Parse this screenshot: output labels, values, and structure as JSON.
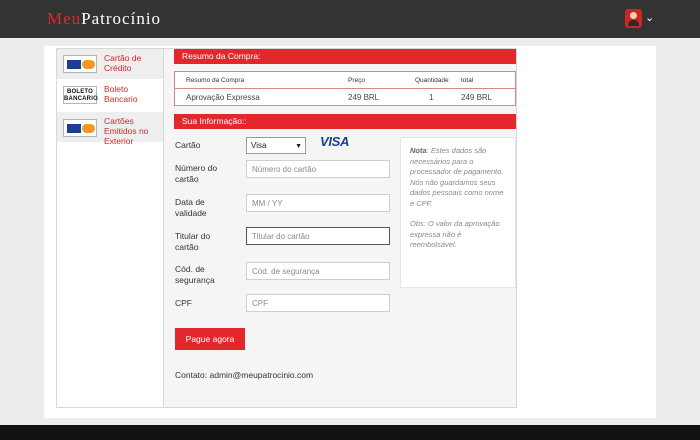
{
  "header": {
    "logo_part1": "Meu",
    "logo_part2": "Patrocínio",
    "user_menu_icon": "chevron-down-icon"
  },
  "sidebar": {
    "items": [
      {
        "label": "Cartão de Crédito",
        "icon": "credit-cards-logo",
        "active": true
      },
      {
        "label": "Boleto Bancario",
        "icon": "boleto-logo",
        "logo_text": "BOLETO BANCARIO",
        "active": false
      },
      {
        "label": "Cartões Emitidos no Exterior",
        "icon": "credit-cards-logo",
        "active": true
      }
    ]
  },
  "summary": {
    "title": "Resumo da Compra:",
    "columns": [
      "Resumo da Compra",
      "Preço",
      "Quantidade",
      "total"
    ],
    "rows": [
      [
        "Aprovação Expressa",
        "249 BRL",
        "1",
        "249 BRL"
      ]
    ]
  },
  "form": {
    "title": "Sua Informação::",
    "card_label": "Cartão",
    "card_selected": "Visa",
    "card_brand": "VISA",
    "number_label": "Número do cartão",
    "number_placeholder": "Número do cartão",
    "expiry_label": "Data de validade",
    "expiry_placeholder": "MM / YY",
    "holder_label": "Titular do cartão",
    "holder_placeholder": "Titular do cartão",
    "cvv_label": "Cód. de segurança",
    "cvv_placeholder": "Cód. de segurança",
    "cpf_label": "CPF",
    "cpf_placeholder": "CPF",
    "submit_label": "Pague agora",
    "contact": "Contato: admin@meupatrocinio.com"
  },
  "note": {
    "nota_label": "Nota",
    "nota_text": ": Estes dados são necessários para o processador de pagamento. Nós não guardamos seus dados pessoais como nome e CPF.",
    "obs_text": "Obs: O valor da aprovação expressa não é reembolsável."
  },
  "colors": {
    "accent": "#e3282d",
    "topbar": "#333333",
    "visa_blue": "#1a3f8f"
  }
}
